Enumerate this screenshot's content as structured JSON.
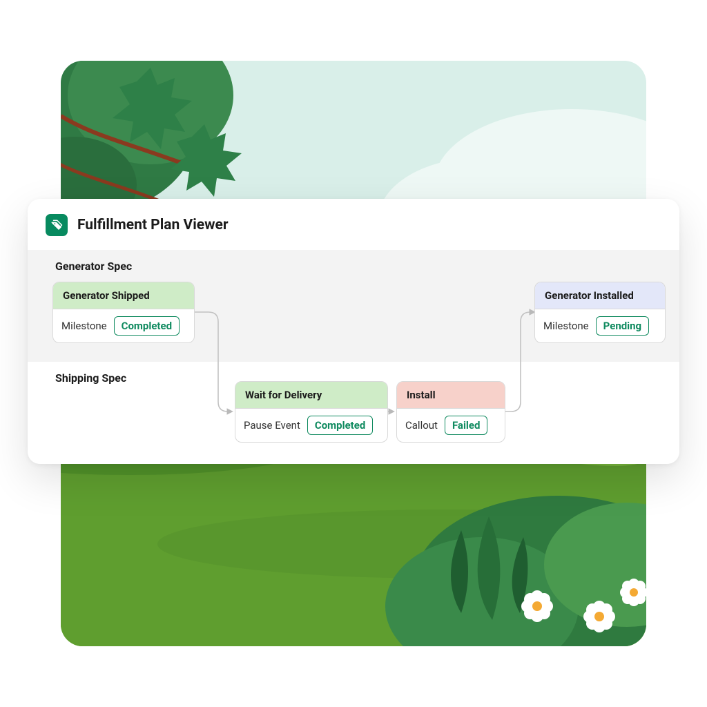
{
  "panel": {
    "title": "Fulfillment Plan Viewer",
    "icon": "tags-icon"
  },
  "sections": {
    "top_label": "Generator Spec",
    "bottom_label": "Shipping Spec"
  },
  "nodes": {
    "generator_shipped": {
      "title": "Generator Shipped",
      "type": "Milestone",
      "status": "Completed",
      "head_color": "green"
    },
    "generator_installed": {
      "title": "Generator Installed",
      "type": "Milestone",
      "status": "Pending",
      "head_color": "blue"
    },
    "wait_for_delivery": {
      "title": "Wait for Delivery",
      "type": "Pause Event",
      "status": "Completed",
      "head_color": "green"
    },
    "install": {
      "title": "Install",
      "type": "Callout",
      "status": "Failed",
      "head_color": "red"
    }
  },
  "colors": {
    "accent_green": "#0f8a5f",
    "head_green": "#cfecc7",
    "head_red": "#f7d1ca",
    "head_blue": "#e3e7f9"
  }
}
